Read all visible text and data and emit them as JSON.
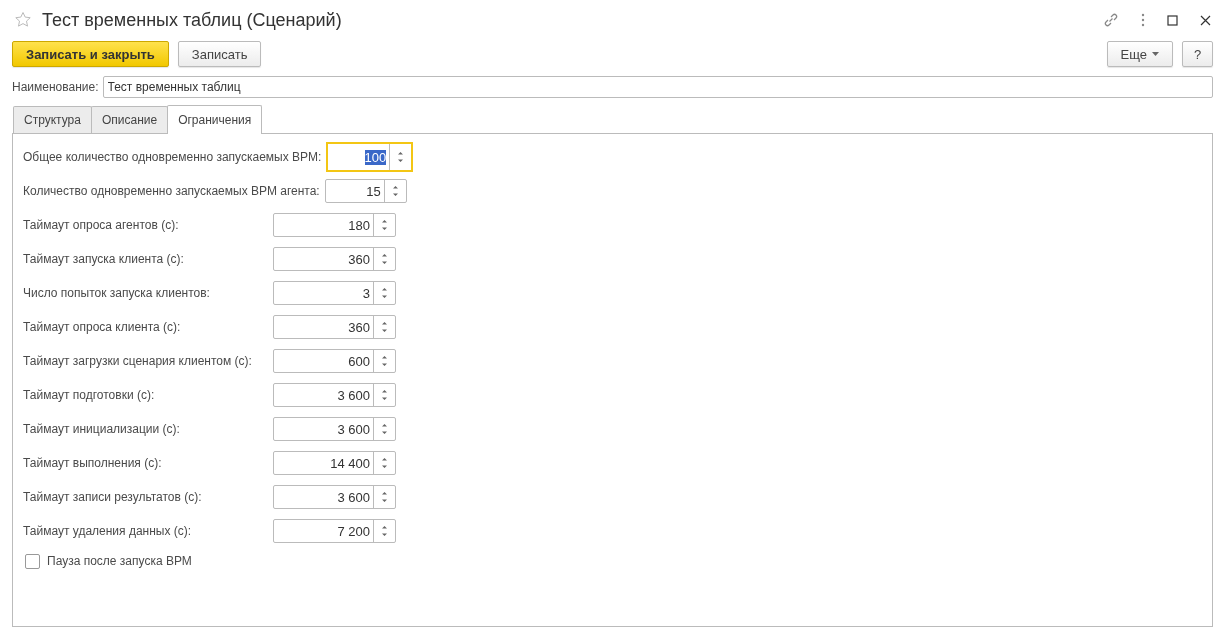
{
  "window": {
    "title": "Тест временных таблиц (Сценарий)",
    "favorite": false
  },
  "toolbar": {
    "buttons": [
      {
        "label": "Записать и закрыть",
        "kind": "primary"
      },
      {
        "label": "Записать",
        "kind": "normal"
      }
    ],
    "more": "Еще",
    "help": "?"
  },
  "name_field": {
    "label": "Наименование:",
    "value": "Тест временных таблиц"
  },
  "tabs": [
    {
      "label": "Структура",
      "selected": false
    },
    {
      "label": "Описание",
      "selected": false
    },
    {
      "label": "Ограничения",
      "selected": true
    }
  ],
  "fields": [
    {
      "label": "Общее количество одновременно запускаемых ВРМ:",
      "value": "100",
      "focused": true,
      "kind": "inline"
    },
    {
      "label": "Количество одновременно запускаемых ВРМ агента:",
      "value": "15",
      "focused": false,
      "kind": "inline"
    },
    {
      "label": "Таймаут опроса агентов (с):",
      "value": "180",
      "focused": false,
      "kind": "aligned"
    },
    {
      "label": "Таймаут запуска клиента (с):",
      "value": "360",
      "focused": false,
      "kind": "aligned"
    },
    {
      "label": "Число попыток запуска клиентов:",
      "value": "3",
      "focused": false,
      "kind": "aligned"
    },
    {
      "label": "Таймаут опроса клиента (с):",
      "value": "360",
      "focused": false,
      "kind": "aligned"
    },
    {
      "label": "Таймаут загрузки сценария клиентом (с):",
      "value": "600",
      "focused": false,
      "kind": "aligned"
    },
    {
      "label": "Таймаут подготовки (с):",
      "value": "3 600",
      "focused": false,
      "kind": "aligned"
    },
    {
      "label": "Таймаут инициализации (с):",
      "value": "3 600",
      "focused": false,
      "kind": "aligned"
    },
    {
      "label": "Таймаут выполнения (с):",
      "value": "14 400",
      "focused": false,
      "kind": "aligned"
    },
    {
      "label": "Таймаут записи результатов (с):",
      "value": "3 600",
      "focused": false,
      "kind": "aligned"
    },
    {
      "label": "Таймаут удаления данных (с):",
      "value": "7 200",
      "focused": false,
      "kind": "aligned"
    }
  ],
  "checkbox": {
    "label": "Пауза после запуска ВРМ",
    "checked": false
  }
}
